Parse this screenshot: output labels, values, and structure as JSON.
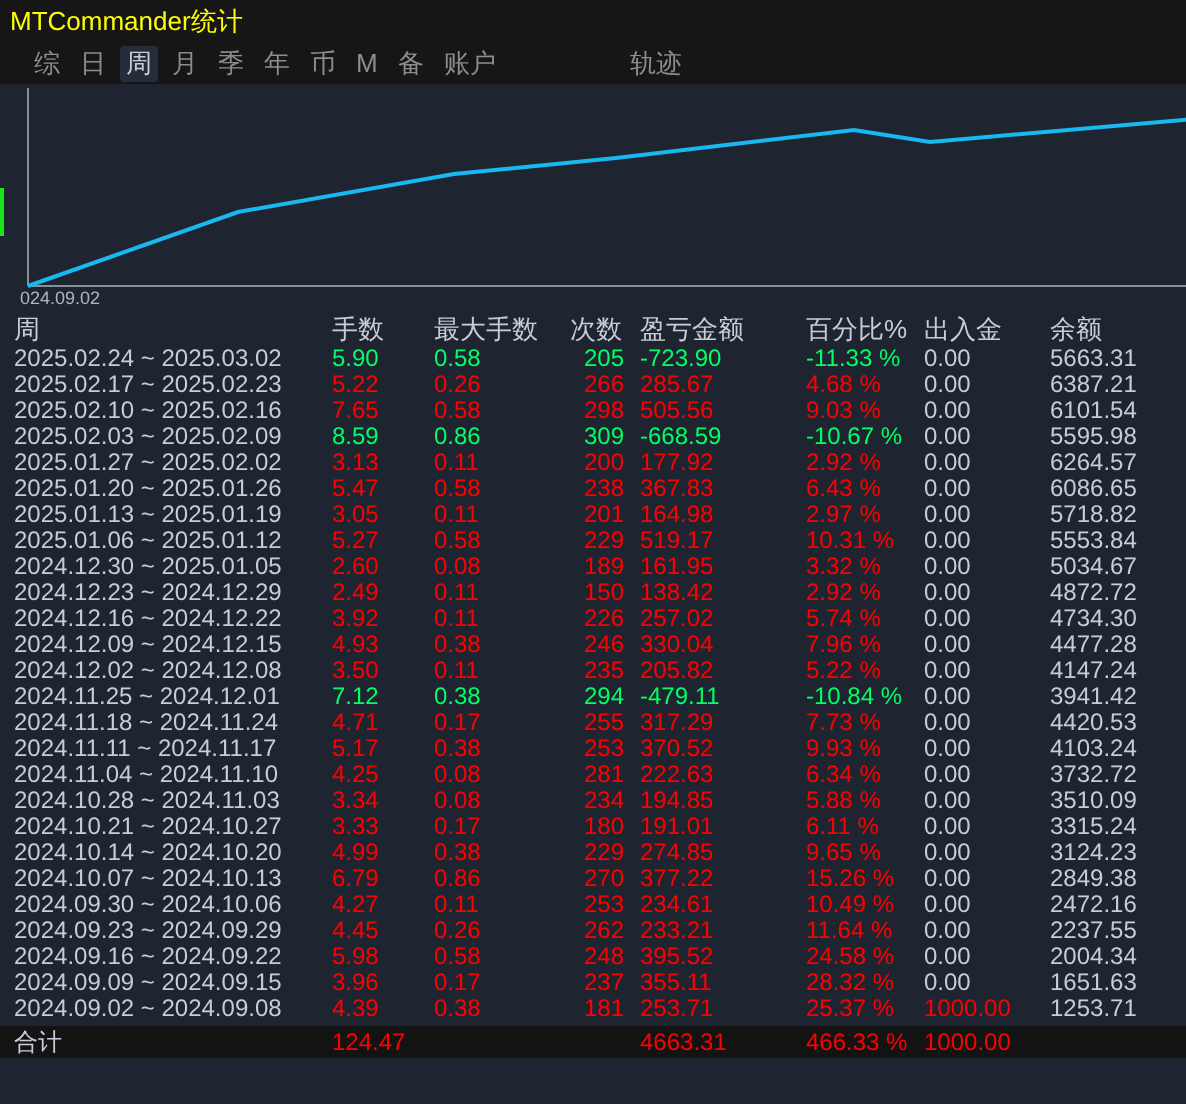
{
  "window": {
    "title": "MTCommander统计"
  },
  "tabs": [
    {
      "label": "综",
      "selected": false
    },
    {
      "label": "日",
      "selected": false
    },
    {
      "label": "周",
      "selected": true
    },
    {
      "label": "月",
      "selected": false
    },
    {
      "label": "季",
      "selected": false
    },
    {
      "label": "年",
      "selected": false
    },
    {
      "label": "币",
      "selected": false
    },
    {
      "label": "M",
      "selected": false
    },
    {
      "label": "备",
      "selected": false
    },
    {
      "label": "账户",
      "selected": false
    },
    {
      "label": "轨迹",
      "selected": false
    }
  ],
  "chart": {
    "x_label": "024.09.02"
  },
  "table": {
    "columns": [
      "周",
      "手数",
      "最大手数",
      "次数",
      "盈亏金额",
      "百分比%",
      "出入金",
      "余额"
    ],
    "rows": [
      {
        "period": "2025.02.24 ~ 2025.03.02",
        "lots": "5.90",
        "max_lots": "0.58",
        "trades": "205",
        "pnl": "-723.90",
        "percent": "-11.33 %",
        "deposit": "0.00",
        "balance": "5663.31",
        "color": "#00ff66",
        "deposit_highlight": false
      },
      {
        "period": "2025.02.17 ~ 2025.02.23",
        "lots": "5.22",
        "max_lots": "0.26",
        "trades": "266",
        "pnl": "285.67",
        "percent": "4.68 %",
        "deposit": "0.00",
        "balance": "6387.21",
        "color": "#ff0000",
        "deposit_highlight": false
      },
      {
        "period": "2025.02.10 ~ 2025.02.16",
        "lots": "7.65",
        "max_lots": "0.58",
        "trades": "298",
        "pnl": "505.56",
        "percent": "9.03 %",
        "deposit": "0.00",
        "balance": "6101.54",
        "color": "#ff0000",
        "deposit_highlight": false
      },
      {
        "period": "2025.02.03 ~ 2025.02.09",
        "lots": "8.59",
        "max_lots": "0.86",
        "trades": "309",
        "pnl": "-668.59",
        "percent": "-10.67 %",
        "deposit": "0.00",
        "balance": "5595.98",
        "color": "#00ff66",
        "deposit_highlight": false
      },
      {
        "period": "2025.01.27 ~ 2025.02.02",
        "lots": "3.13",
        "max_lots": "0.11",
        "trades": "200",
        "pnl": "177.92",
        "percent": "2.92 %",
        "deposit": "0.00",
        "balance": "6264.57",
        "color": "#ff0000",
        "deposit_highlight": false
      },
      {
        "period": "2025.01.20 ~ 2025.01.26",
        "lots": "5.47",
        "max_lots": "0.58",
        "trades": "238",
        "pnl": "367.83",
        "percent": "6.43 %",
        "deposit": "0.00",
        "balance": "6086.65",
        "color": "#ff0000",
        "deposit_highlight": false
      },
      {
        "period": "2025.01.13 ~ 2025.01.19",
        "lots": "3.05",
        "max_lots": "0.11",
        "trades": "201",
        "pnl": "164.98",
        "percent": "2.97 %",
        "deposit": "0.00",
        "balance": "5718.82",
        "color": "#ff0000",
        "deposit_highlight": false
      },
      {
        "period": "2025.01.06 ~ 2025.01.12",
        "lots": "5.27",
        "max_lots": "0.58",
        "trades": "229",
        "pnl": "519.17",
        "percent": "10.31 %",
        "deposit": "0.00",
        "balance": "5553.84",
        "color": "#ff0000",
        "deposit_highlight": false
      },
      {
        "period": "2024.12.30 ~ 2025.01.05",
        "lots": "2.60",
        "max_lots": "0.08",
        "trades": "189",
        "pnl": "161.95",
        "percent": "3.32 %",
        "deposit": "0.00",
        "balance": "5034.67",
        "color": "#ff0000",
        "deposit_highlight": false
      },
      {
        "period": "2024.12.23 ~ 2024.12.29",
        "lots": "2.49",
        "max_lots": "0.11",
        "trades": "150",
        "pnl": "138.42",
        "percent": "2.92 %",
        "deposit": "0.00",
        "balance": "4872.72",
        "color": "#ff0000",
        "deposit_highlight": false
      },
      {
        "period": "2024.12.16 ~ 2024.12.22",
        "lots": "3.92",
        "max_lots": "0.11",
        "trades": "226",
        "pnl": "257.02",
        "percent": "5.74 %",
        "deposit": "0.00",
        "balance": "4734.30",
        "color": "#ff0000",
        "deposit_highlight": false
      },
      {
        "period": "2024.12.09 ~ 2024.12.15",
        "lots": "4.93",
        "max_lots": "0.38",
        "trades": "246",
        "pnl": "330.04",
        "percent": "7.96 %",
        "deposit": "0.00",
        "balance": "4477.28",
        "color": "#ff0000",
        "deposit_highlight": false
      },
      {
        "period": "2024.12.02 ~ 2024.12.08",
        "lots": "3.50",
        "max_lots": "0.11",
        "trades": "235",
        "pnl": "205.82",
        "percent": "5.22 %",
        "deposit": "0.00",
        "balance": "4147.24",
        "color": "#ff0000",
        "deposit_highlight": false
      },
      {
        "period": "2024.11.25 ~ 2024.12.01",
        "lots": "7.12",
        "max_lots": "0.38",
        "trades": "294",
        "pnl": "-479.11",
        "percent": "-10.84 %",
        "deposit": "0.00",
        "balance": "3941.42",
        "color": "#00ff66",
        "deposit_highlight": false
      },
      {
        "period": "2024.11.18 ~ 2024.11.24",
        "lots": "4.71",
        "max_lots": "0.17",
        "trades": "255",
        "pnl": "317.29",
        "percent": "7.73 %",
        "deposit": "0.00",
        "balance": "4420.53",
        "color": "#ff0000",
        "deposit_highlight": false
      },
      {
        "period": "2024.11.11 ~ 2024.11.17",
        "lots": "5.17",
        "max_lots": "0.38",
        "trades": "253",
        "pnl": "370.52",
        "percent": "9.93 %",
        "deposit": "0.00",
        "balance": "4103.24",
        "color": "#ff0000",
        "deposit_highlight": false
      },
      {
        "period": "2024.11.04 ~ 2024.11.10",
        "lots": "4.25",
        "max_lots": "0.08",
        "trades": "281",
        "pnl": "222.63",
        "percent": "6.34 %",
        "deposit": "0.00",
        "balance": "3732.72",
        "color": "#ff0000",
        "deposit_highlight": false
      },
      {
        "period": "2024.10.28 ~ 2024.11.03",
        "lots": "3.34",
        "max_lots": "0.08",
        "trades": "234",
        "pnl": "194.85",
        "percent": "5.88 %",
        "deposit": "0.00",
        "balance": "3510.09",
        "color": "#ff0000",
        "deposit_highlight": false
      },
      {
        "period": "2024.10.21 ~ 2024.10.27",
        "lots": "3.33",
        "max_lots": "0.17",
        "trades": "180",
        "pnl": "191.01",
        "percent": "6.11 %",
        "deposit": "0.00",
        "balance": "3315.24",
        "color": "#ff0000",
        "deposit_highlight": false
      },
      {
        "period": "2024.10.14 ~ 2024.10.20",
        "lots": "4.99",
        "max_lots": "0.38",
        "trades": "229",
        "pnl": "274.85",
        "percent": "9.65 %",
        "deposit": "0.00",
        "balance": "3124.23",
        "color": "#ff0000",
        "deposit_highlight": false
      },
      {
        "period": "2024.10.07 ~ 2024.10.13",
        "lots": "6.79",
        "max_lots": "0.86",
        "trades": "270",
        "pnl": "377.22",
        "percent": "15.26 %",
        "deposit": "0.00",
        "balance": "2849.38",
        "color": "#ff0000",
        "deposit_highlight": false
      },
      {
        "period": "2024.09.30 ~ 2024.10.06",
        "lots": "4.27",
        "max_lots": "0.11",
        "trades": "253",
        "pnl": "234.61",
        "percent": "10.49 %",
        "deposit": "0.00",
        "balance": "2472.16",
        "color": "#ff0000",
        "deposit_highlight": false
      },
      {
        "period": "2024.09.23 ~ 2024.09.29",
        "lots": "4.45",
        "max_lots": "0.26",
        "trades": "262",
        "pnl": "233.21",
        "percent": "11.64 %",
        "deposit": "0.00",
        "balance": "2237.55",
        "color": "#ff0000",
        "deposit_highlight": false
      },
      {
        "period": "2024.09.16 ~ 2024.09.22",
        "lots": "5.98",
        "max_lots": "0.58",
        "trades": "248",
        "pnl": "395.52",
        "percent": "24.58 %",
        "deposit": "0.00",
        "balance": "2004.34",
        "color": "#ff0000",
        "deposit_highlight": false
      },
      {
        "period": "2024.09.09 ~ 2024.09.15",
        "lots": "3.96",
        "max_lots": "0.17",
        "trades": "237",
        "pnl": "355.11",
        "percent": "28.32 %",
        "deposit": "0.00",
        "balance": "1651.63",
        "color": "#ff0000",
        "deposit_highlight": false
      },
      {
        "period": "2024.09.02 ~ 2024.09.08",
        "lots": "4.39",
        "max_lots": "0.38",
        "trades": "181",
        "pnl": "253.71",
        "percent": "25.37 %",
        "deposit": "1000.00",
        "balance": "1253.71",
        "color": "#ff0000",
        "deposit_highlight": true
      }
    ],
    "total": {
      "label": "合计",
      "lots": "124.47",
      "pnl": "4663.31",
      "percent": "466.33 %",
      "deposit": "1000.00"
    }
  }
}
